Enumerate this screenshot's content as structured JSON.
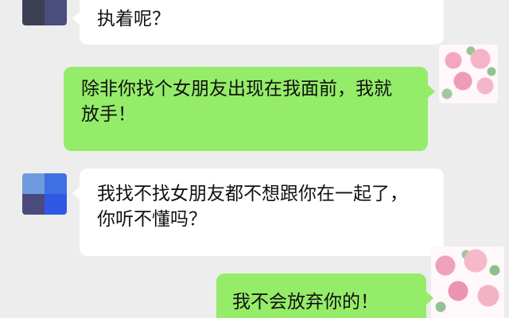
{
  "chat": {
    "messages": [
      {
        "side": "left",
        "text": "执着呢？",
        "avatar": "glitched-avatar"
      },
      {
        "side": "right",
        "text": "除非你找个女朋友出现在我面前，我就放手！",
        "avatar": "floral-avatar"
      },
      {
        "side": "left",
        "text": "我找不找女朋友都不想跟你在一起了，你听不懂吗？",
        "avatar": "pixel-avatar"
      },
      {
        "side": "right",
        "text": "我不会放弃你的！",
        "avatar": "floral-avatar"
      }
    ]
  },
  "colors": {
    "background": "#ededed",
    "left_bubble": "#ffffff",
    "right_bubble": "#95ec69",
    "text": "#111111"
  }
}
